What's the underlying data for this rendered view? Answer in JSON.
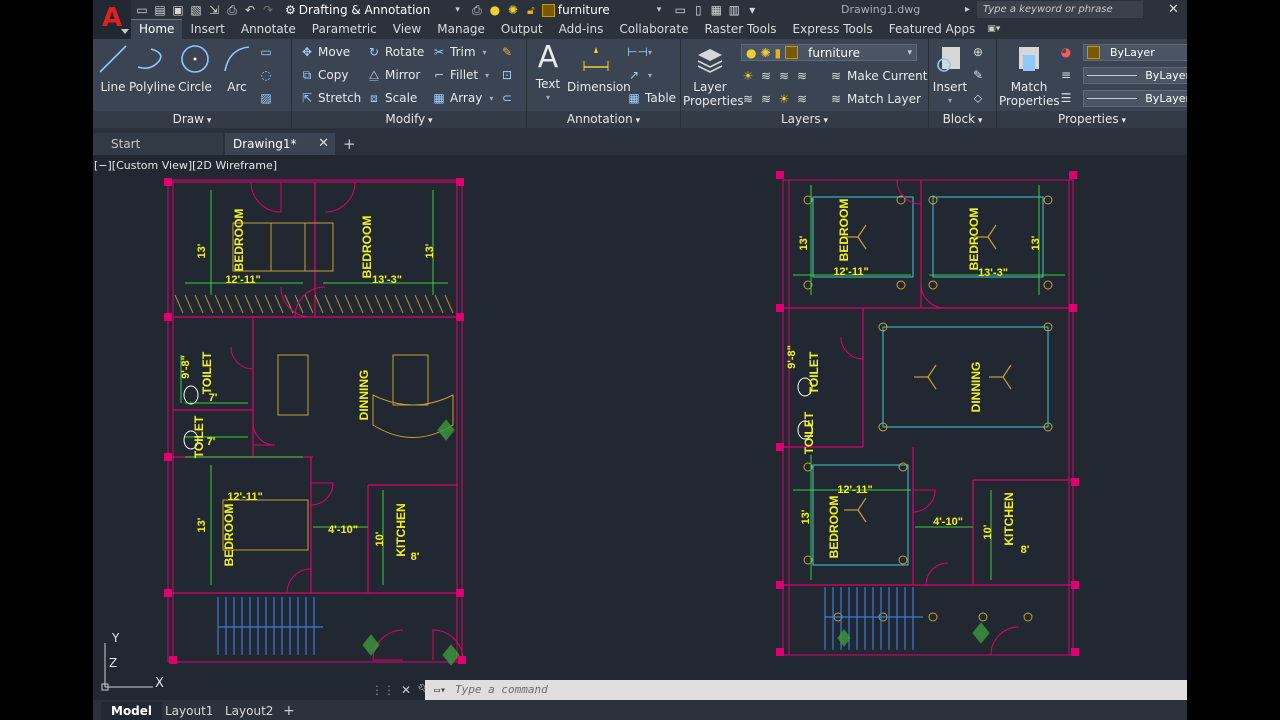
{
  "app": {
    "logo_letter": "A",
    "brand_color": "#e0201b",
    "document_title": "Drawing1.dwg"
  },
  "quick_access": {
    "icons": [
      "new-icon",
      "open-icon",
      "save-icon",
      "save-as-icon",
      "web-icon",
      "print-icon",
      "undo-icon",
      "redo-icon"
    ],
    "workspace": "Drafting & Annotation",
    "layer": "furniture"
  },
  "search": {
    "placeholder": "Type a keyword or phrase"
  },
  "ribbon_tabs": [
    "Home",
    "Insert",
    "Annotate",
    "Parametric",
    "View",
    "Manage",
    "Output",
    "Add-ins",
    "Collaborate",
    "Raster Tools",
    "Express Tools",
    "Featured Apps"
  ],
  "panels": {
    "draw": {
      "title": "Draw",
      "tools": [
        "Line",
        "Polyline",
        "Circle",
        "Arc"
      ]
    },
    "modify": {
      "title": "Modify",
      "tools": [
        "Move",
        "Rotate",
        "Trim",
        "Copy",
        "Mirror",
        "Fillet",
        "Stretch",
        "Scale",
        "Array"
      ]
    },
    "annotation": {
      "title": "Annotation",
      "text": "Text",
      "dimension": "Dimension",
      "table": "Table"
    },
    "layers": {
      "title": "Layers",
      "layer_properties": "Layer\nProperties",
      "current_layer": "furniture",
      "make_current": "Make Current",
      "match_layer": "Match Layer"
    },
    "block": {
      "title": "Block",
      "insert": "Insert"
    },
    "properties": {
      "title": "Properties",
      "match_properties": "Match\nProperties",
      "color": "ByLayer",
      "linetype": "ByLayer",
      "lineweight": "ByLayer"
    }
  },
  "doc_tabs": {
    "start": "Start",
    "drawing": "Drawing1*"
  },
  "viewport": {
    "label": "[−][Custom View][2D Wireframe]"
  },
  "plans": {
    "left": {
      "room_labels": [
        "BEDROOM",
        "BEDROOM",
        "TOILET",
        "TOILET",
        "DINNING",
        "BEDROOM",
        "KITCHEN"
      ],
      "dims": [
        "13'",
        "12'-11\"",
        "13'-3\"",
        "13'",
        "9'-8\"",
        "7'",
        "7'",
        "12'-11\"",
        "13'",
        "4'-10\"",
        "10'",
        "8'"
      ]
    },
    "right": {
      "room_labels": [
        "BEDROOM",
        "BEDROOM",
        "TOILET",
        "TOILET",
        "DINNING",
        "BEDROOM",
        "KITCHEN"
      ],
      "dims": [
        "13'",
        "12'-11\"",
        "13'-3\"",
        "13'",
        "9'-8\"",
        "12'-11\"",
        "13'",
        "4'-10\"",
        "10'",
        "8'"
      ]
    }
  },
  "ucs": {
    "x": "X",
    "y": "Y",
    "z": "Z"
  },
  "command": {
    "placeholder": "Type a command"
  },
  "layout_tabs": [
    "Model",
    "Layout1",
    "Layout2"
  ],
  "colors": {
    "walls": "#e0006e",
    "dimensions": "#39d139",
    "labels": "#f2f21e",
    "fixtures": "#c8a032",
    "stairs": "#3a7bd5",
    "plants": "#3c9a3c",
    "ceiling": "#40c8d8"
  }
}
